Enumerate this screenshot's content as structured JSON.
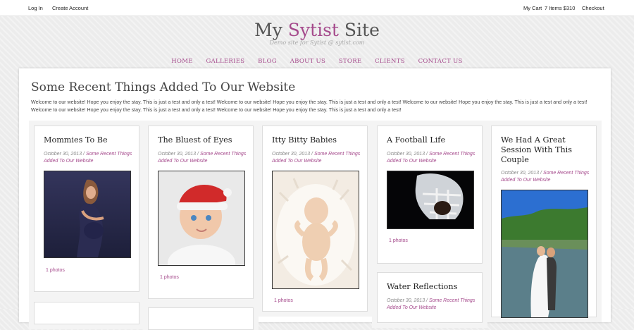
{
  "topbar": {
    "login": "Log In",
    "create_account": "Create Account",
    "cart": "My Cart",
    "cart_summary": "7 Items $310",
    "checkout": "Checkout"
  },
  "brand": {
    "title_prefix": "My ",
    "title_accent": "Sytist",
    "title_suffix": " Site",
    "tagline": "Demo site for Sytist @ sytist.com",
    "accent_color": "#a54a8c"
  },
  "nav": [
    "HOME",
    "GALLERIES",
    "BLOG",
    "ABOUT US",
    "STORE",
    "CLIENTS",
    "CONTACT US"
  ],
  "main": {
    "heading": "Some Recent Things Added To Our Website",
    "intro": "Welcome to our website! Hope you enjoy the stay. This is just a test and only a test! Welcome to our website! Hope you enjoy the stay. This is just a test and only a test! Welcome to our website! Hope you enjoy the stay. This is just a test and only a test! Welcome to our website! Hope you enjoy the stay. This is just a test and only a test! Welcome to our website! Hope you enjoy the stay. This is just a test and only a test!"
  },
  "cards": [
    {
      "title": "Mommies To Be",
      "date": "October 30, 2013",
      "category": "Some Recent Things Added To Our Website",
      "count": "1 photos",
      "photo": "maternity-photo"
    },
    {
      "title": "The Bluest of Eyes",
      "date": "October 30, 2013",
      "category": "Some Recent Things Added To Our Website",
      "count": "1 photos",
      "photo": "baby-santa-hat-photo"
    },
    {
      "title": "Itty Bitty Babies",
      "date": "October 30, 2013",
      "category": "Some Recent Things Added To Our Website",
      "count": "1 photos",
      "photo": "newborn-feathers-photo"
    },
    {
      "title": "A Football Life",
      "date": "October 30, 2013",
      "category": "Some Recent Things Added To Our Website",
      "count": "1 photos",
      "photo": "football-helmet-photo"
    },
    {
      "title": "We Had A Great Session With This Couple",
      "date": "October 30, 2013",
      "category": "Some Recent Things Added To Our Website",
      "count": "",
      "photo": "wedding-couple-photo"
    },
    {
      "title": "Water Reflections",
      "date": "October 30, 2013",
      "category": "Some Recent Things Added To Our Website",
      "count": "",
      "photo": ""
    }
  ]
}
